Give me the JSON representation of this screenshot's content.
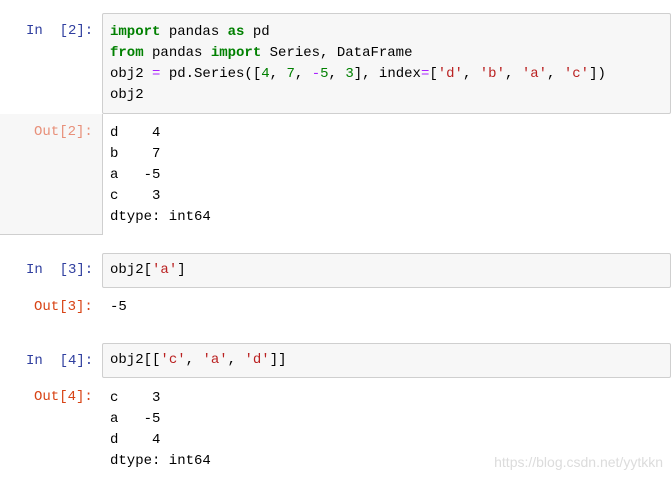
{
  "cells": [
    {
      "in_prompt": "In  [2]:",
      "out_prompt": "Out[2]:",
      "code": {
        "l1": {
          "kw1": "import",
          "t1": " pandas ",
          "kw2": "as",
          "t2": " pd"
        },
        "l2": {
          "kw1": "from",
          "t1": " pandas ",
          "kw2": "import",
          "t2": " Series, DataFrame"
        },
        "l3": {
          "t1": "obj2 ",
          "op1": "=",
          "t2": " pd.Series([",
          "n1": "4",
          "t3": ", ",
          "n2": "7",
          "t4": ", ",
          "op2": "-",
          "n3": "5",
          "t5": ", ",
          "n4": "3",
          "t6": "], index",
          "op3": "=",
          "t7": "[",
          "s1": "'d'",
          "t8": ", ",
          "s2": "'b'",
          "t9": ", ",
          "s3": "'a'",
          "t10": ", ",
          "s4": "'c'",
          "t11": "])"
        },
        "l4": "obj2"
      },
      "output": [
        "d    4",
        "b    7",
        "a   -5",
        "c    3",
        "dtype: int64"
      ]
    },
    {
      "in_prompt": "In  [3]:",
      "out_prompt": "Out[3]:",
      "code": {
        "t1": "obj2[",
        "s1": "'a'",
        "t2": "]"
      },
      "output": [
        "-5"
      ]
    },
    {
      "in_prompt": "In  [4]:",
      "out_prompt": "Out[4]:",
      "code": {
        "t1": "obj2[[",
        "s1": "'c'",
        "t2": ", ",
        "s2": "'a'",
        "t3": ", ",
        "s3": "'d'",
        "t4": "]]"
      },
      "output": [
        "c    3",
        "a   -5",
        "d    4",
        "dtype: int64"
      ]
    }
  ],
  "watermark": "https://blog.csdn.net/yytkkn",
  "colors": {
    "in_prompt": "#303f9f",
    "out_prompt": "#d84315",
    "keyword": "#008000",
    "number": "#008000",
    "string": "#ba2121",
    "operator": "#aa22ff",
    "cell_bg": "#f7f7f7",
    "border": "#cfcfcf"
  }
}
